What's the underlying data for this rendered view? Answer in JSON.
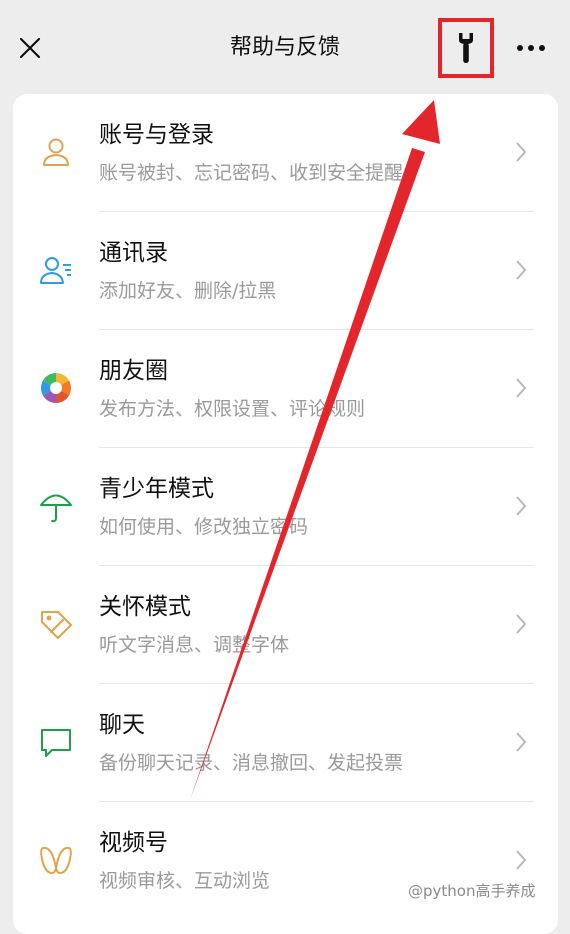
{
  "header": {
    "title": "帮助与反馈",
    "close_icon": "close-icon",
    "wrench_icon": "wrench-icon",
    "more_icon": "more-dots-icon"
  },
  "items": [
    {
      "label": "账号与登录",
      "desc": "账号被封、忘记密码、收到安全提醒",
      "icon": "account-icon",
      "color": "#e0a24a"
    },
    {
      "label": "通讯录",
      "desc": "添加好友、删除/拉黑",
      "icon": "contacts-icon",
      "color": "#2f9be0"
    },
    {
      "label": "朋友圈",
      "desc": "发布方法、权限设置、评论规则",
      "icon": "moments-icon",
      "color": "#e0542f"
    },
    {
      "label": "青少年模式",
      "desc": "如何使用、修改独立密码",
      "icon": "umbrella-icon",
      "color": "#1f9e4a"
    },
    {
      "label": "关怀模式",
      "desc": "听文字消息、调整字体",
      "icon": "care-tag-icon",
      "color": "#e0a24a"
    },
    {
      "label": "聊天",
      "desc": "备份聊天记录、消息撤回、发起投票",
      "icon": "chat-bubble-icon",
      "color": "#1f9e4a"
    },
    {
      "label": "视频号",
      "desc": "视频审核、互动浏览",
      "icon": "channels-icon",
      "color": "#e0a24a"
    }
  ],
  "watermark": "@python高手养成",
  "annotation_color": "#e3262b"
}
